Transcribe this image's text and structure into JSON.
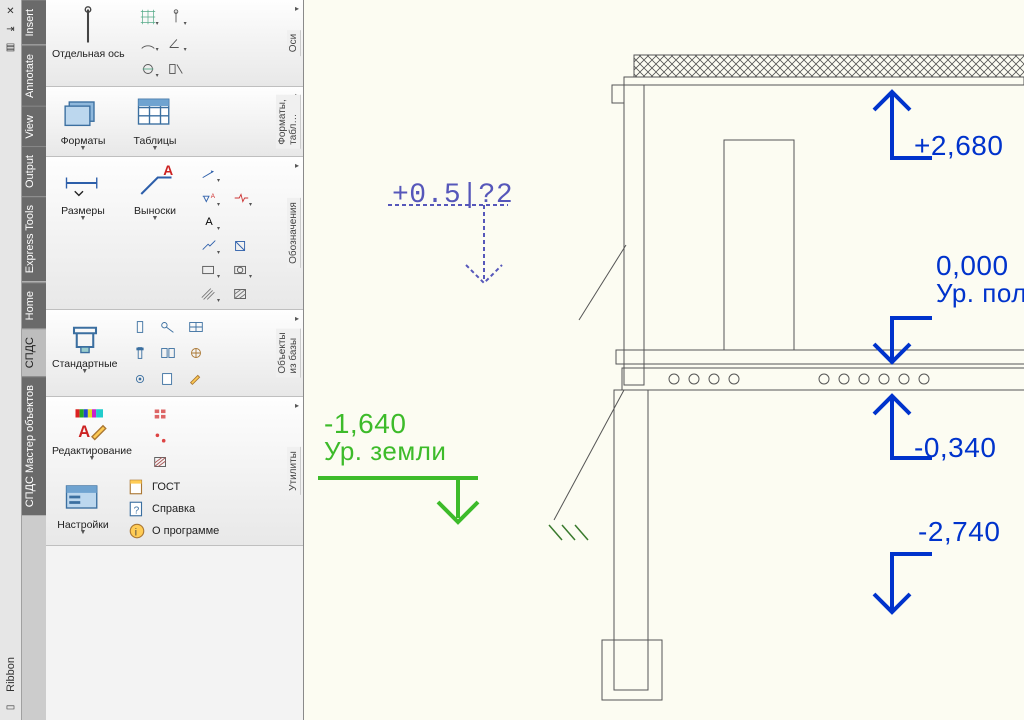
{
  "window": {
    "title": "Ribbon"
  },
  "tabs": {
    "items": [
      {
        "label": "Insert"
      },
      {
        "label": "Annotate"
      },
      {
        "label": "View"
      },
      {
        "label": "Output"
      },
      {
        "label": "Express Tools"
      },
      {
        "label": "Home"
      },
      {
        "label": "СПДС",
        "active": true
      },
      {
        "label": "СПДС Мастер объектов"
      }
    ]
  },
  "panels": {
    "axes": {
      "title": "Оси",
      "big_label": "Отдельная ось"
    },
    "formats": {
      "title": "Форматы, табл…",
      "formats_label": "Форматы",
      "tables_label": "Таблицы"
    },
    "dims": {
      "title": "Обозначения",
      "dims_label": "Размеры",
      "leaders_label": "Выноски"
    },
    "database": {
      "title": "Объекты из базы",
      "std_label": "Стандартные"
    },
    "utilities": {
      "title": "Утилиты",
      "edit_label": "Редактирование",
      "settings_label": "Настройки",
      "gost_label": "ГОСТ",
      "help_label": "Справка",
      "about_label": "О программе"
    }
  },
  "drawing": {
    "editing_elev": "+0.5|?2",
    "ground": {
      "value": "-1,640",
      "label": "Ур. земли"
    },
    "top": {
      "value": "+2,680"
    },
    "floor": {
      "value": "0,000",
      "label": "Ур. пола"
    },
    "below1": {
      "value": "-0,340"
    },
    "below2": {
      "value": "-2,740"
    }
  }
}
